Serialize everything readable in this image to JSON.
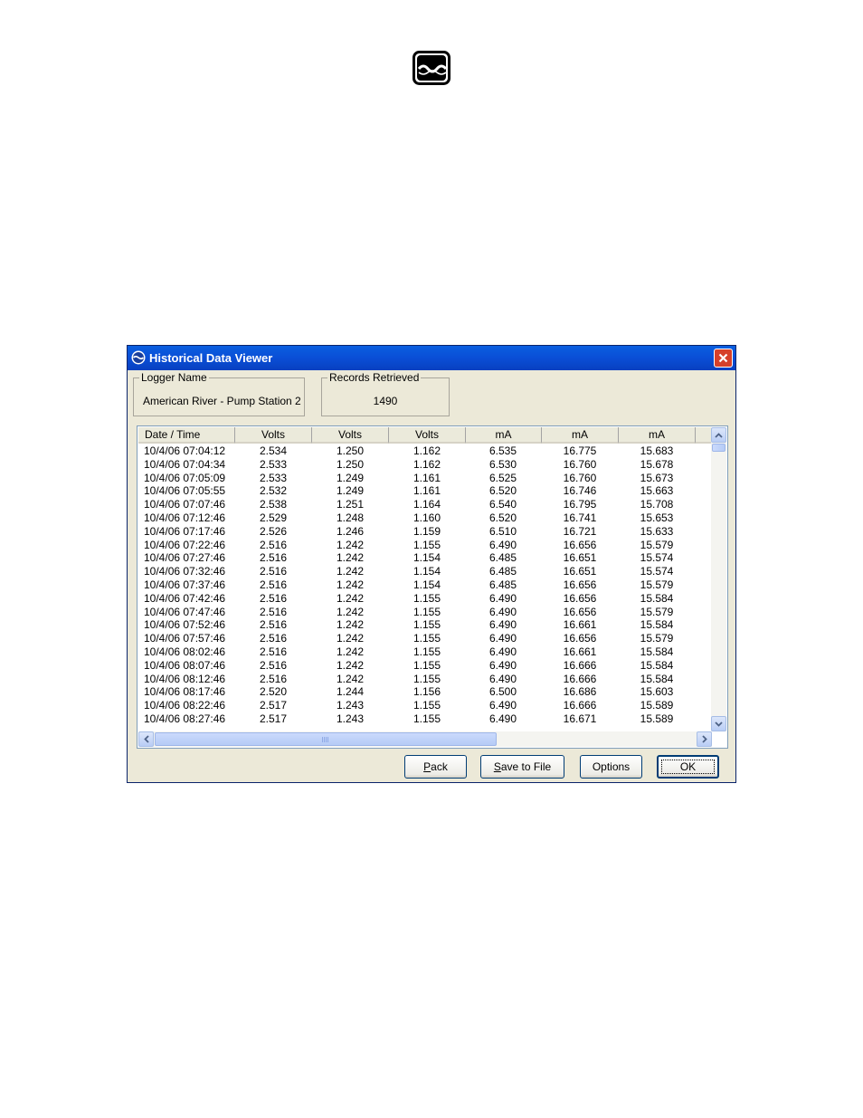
{
  "logo": {
    "icon": "water-wave-logo"
  },
  "window": {
    "title": "Historical Data Viewer",
    "icon": "wave-app-icon",
    "close_icon": "close-icon"
  },
  "logger_name": {
    "legend": "Logger Name",
    "value": "American River - Pump Station 2"
  },
  "records_retrieved": {
    "legend": "Records Retrieved",
    "value": "1490"
  },
  "table": {
    "columns": [
      "Date / Time",
      "Volts",
      "Volts",
      "Volts",
      "mA",
      "mA",
      "mA"
    ],
    "rows": [
      [
        "10/4/06 07:04:12",
        "2.534",
        "1.250",
        "1.162",
        "6.535",
        "16.775",
        "15.683"
      ],
      [
        "10/4/06 07:04:34",
        "2.533",
        "1.250",
        "1.162",
        "6.530",
        "16.760",
        "15.678"
      ],
      [
        "10/4/06 07:05:09",
        "2.533",
        "1.249",
        "1.161",
        "6.525",
        "16.760",
        "15.673"
      ],
      [
        "10/4/06 07:05:55",
        "2.532",
        "1.249",
        "1.161",
        "6.520",
        "16.746",
        "15.663"
      ],
      [
        "10/4/06 07:07:46",
        "2.538",
        "1.251",
        "1.164",
        "6.540",
        "16.795",
        "15.708"
      ],
      [
        "10/4/06 07:12:46",
        "2.529",
        "1.248",
        "1.160",
        "6.520",
        "16.741",
        "15.653"
      ],
      [
        "10/4/06 07:17:46",
        "2.526",
        "1.246",
        "1.159",
        "6.510",
        "16.721",
        "15.633"
      ],
      [
        "10/4/06 07:22:46",
        "2.516",
        "1.242",
        "1.155",
        "6.490",
        "16.656",
        "15.579"
      ],
      [
        "10/4/06 07:27:46",
        "2.516",
        "1.242",
        "1.154",
        "6.485",
        "16.651",
        "15.574"
      ],
      [
        "10/4/06 07:32:46",
        "2.516",
        "1.242",
        "1.154",
        "6.485",
        "16.651",
        "15.574"
      ],
      [
        "10/4/06 07:37:46",
        "2.516",
        "1.242",
        "1.154",
        "6.485",
        "16.656",
        "15.579"
      ],
      [
        "10/4/06 07:42:46",
        "2.516",
        "1.242",
        "1.155",
        "6.490",
        "16.656",
        "15.584"
      ],
      [
        "10/4/06 07:47:46",
        "2.516",
        "1.242",
        "1.155",
        "6.490",
        "16.656",
        "15.579"
      ],
      [
        "10/4/06 07:52:46",
        "2.516",
        "1.242",
        "1.155",
        "6.490",
        "16.661",
        "15.584"
      ],
      [
        "10/4/06 07:57:46",
        "2.516",
        "1.242",
        "1.155",
        "6.490",
        "16.656",
        "15.579"
      ],
      [
        "10/4/06 08:02:46",
        "2.516",
        "1.242",
        "1.155",
        "6.490",
        "16.661",
        "15.584"
      ],
      [
        "10/4/06 08:07:46",
        "2.516",
        "1.242",
        "1.155",
        "6.490",
        "16.666",
        "15.584"
      ],
      [
        "10/4/06 08:12:46",
        "2.516",
        "1.242",
        "1.155",
        "6.490",
        "16.666",
        "15.584"
      ],
      [
        "10/4/06 08:17:46",
        "2.520",
        "1.244",
        "1.156",
        "6.500",
        "16.686",
        "15.603"
      ],
      [
        "10/4/06 08:22:46",
        "2.517",
        "1.243",
        "1.155",
        "6.490",
        "16.666",
        "15.589"
      ],
      [
        "10/4/06 08:27:46",
        "2.517",
        "1.243",
        "1.155",
        "6.490",
        "16.671",
        "15.589"
      ]
    ]
  },
  "buttons": {
    "pack": "Pack",
    "save": "Save to File",
    "options": "Options",
    "ok": "OK"
  },
  "colors": {
    "title_bar": "#0a4ed6",
    "dialog_bg": "#ece9d8",
    "close_button": "#d6402a"
  }
}
